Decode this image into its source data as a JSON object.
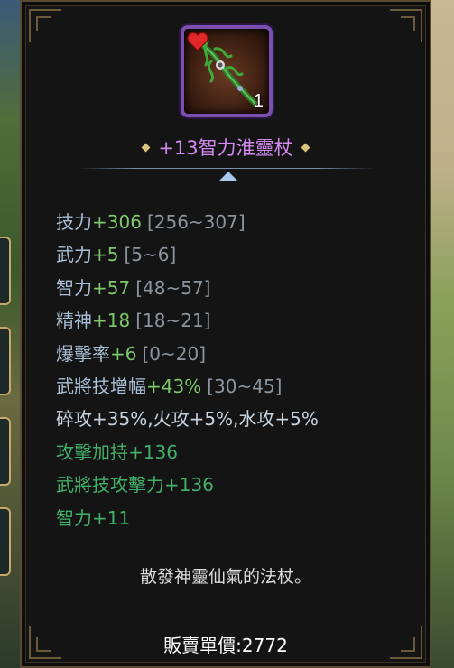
{
  "item": {
    "name": "+13智力淮靈杖",
    "count": "1",
    "icon": "magic-staff-icon",
    "badge_icon": "heart-icon",
    "rarity_color": "#7a4fb0"
  },
  "stats": [
    {
      "name": "技力",
      "value": "+306",
      "range": "[256~307]"
    },
    {
      "name": "武力",
      "value": "+5",
      "range": "[5~6]"
    },
    {
      "name": "智力",
      "value": "+57",
      "range": "[48~57]"
    },
    {
      "name": "精神",
      "value": "+18",
      "range": "[18~21]"
    },
    {
      "name": "爆擊率",
      "value": "+6",
      "range": "[0~20]"
    },
    {
      "name": "武將技增幅",
      "value": "+43%",
      "range": "[30~45]"
    }
  ],
  "element_attack": "碎攻+35%,火攻+5%,水攻+5%",
  "bonus_stats": [
    "攻擊加持+136",
    "武將技攻擊力+136",
    "智力+11"
  ],
  "description": "散發神靈仙氣的法杖。",
  "price_label": "販賣單價:2772",
  "colors": {
    "name_color": "#d38af0",
    "stat_label": "#a9bfd6",
    "stat_value": "#7cc86a",
    "bonus": "#43b06a"
  }
}
